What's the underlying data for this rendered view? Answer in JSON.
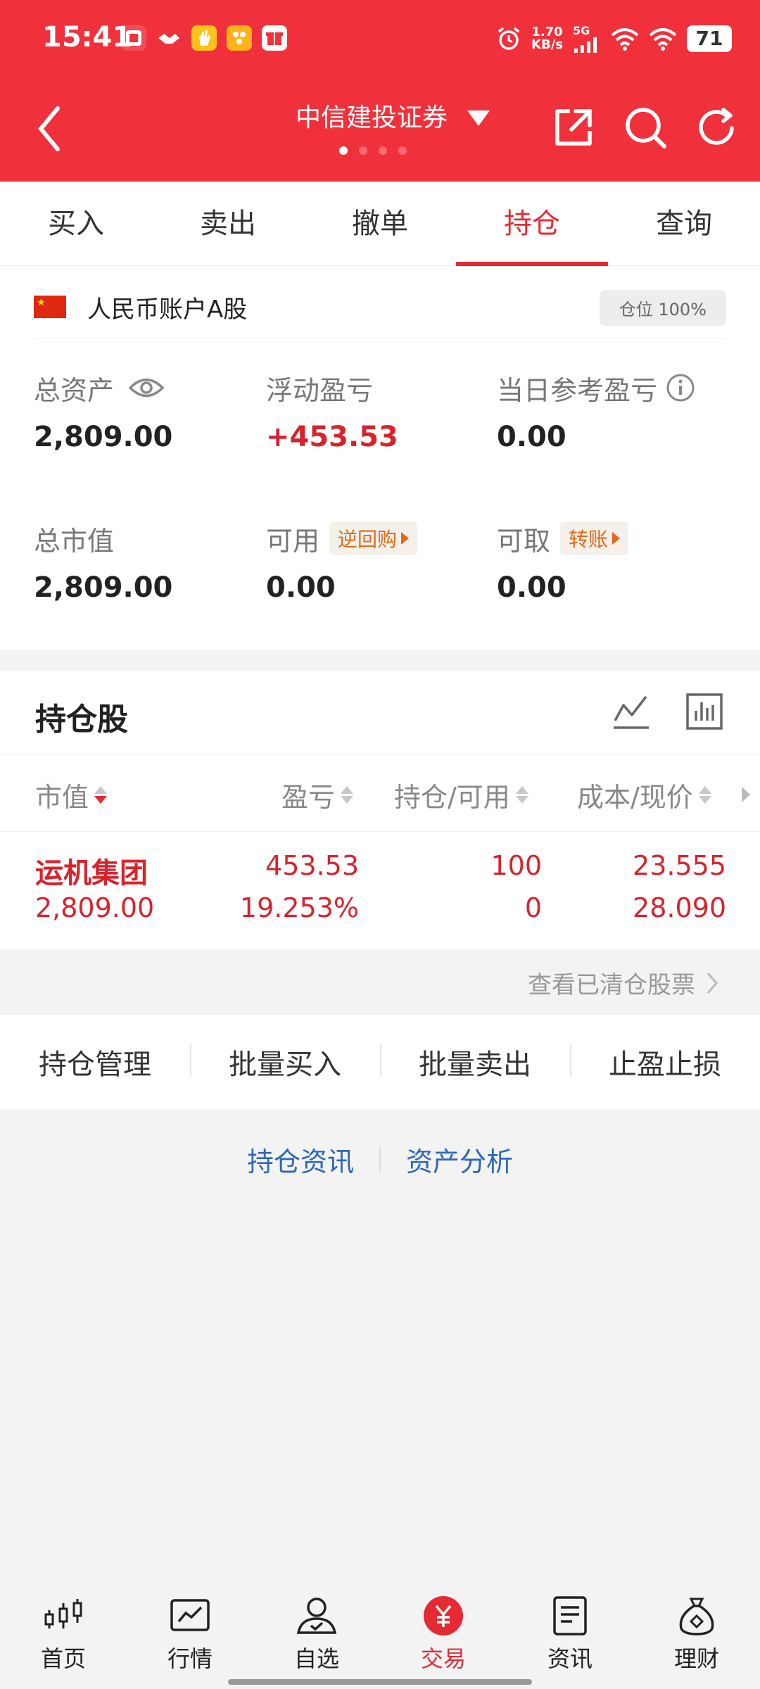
{
  "status_bar": {
    "time": "15:41",
    "speed_value": "1.70",
    "speed_unit": "KB/s",
    "network": "5G",
    "battery": "71"
  },
  "nav": {
    "title": "中信建投证券"
  },
  "tabs": [
    {
      "label": "买入"
    },
    {
      "label": "卖出"
    },
    {
      "label": "撤单"
    },
    {
      "label": "持仓",
      "active": true
    },
    {
      "label": "查询"
    }
  ],
  "account": {
    "name": "人民币账户A股",
    "position_badge": "仓位 100%",
    "total_assets_label": "总资产",
    "total_assets": "2,809.00",
    "floating_pl_label": "浮动盈亏",
    "floating_pl": "+453.53",
    "daily_pl_label": "当日参考盈亏",
    "daily_pl": "0.00",
    "market_value_label": "总市值",
    "market_value": "2,809.00",
    "available_label": "可用",
    "available_tag": "逆回购",
    "available": "0.00",
    "withdrawable_label": "可取",
    "withdrawable_tag": "转账",
    "withdrawable": "0.00"
  },
  "holdings": {
    "title": "持仓股",
    "columns": [
      "市值",
      "盈亏",
      "持仓/可用",
      "成本/现价"
    ],
    "rows": [
      {
        "name": "运机集团",
        "market_value": "2,809.00",
        "pl": "453.53",
        "pl_pct": "19.253%",
        "position": "100",
        "available": "0",
        "cost": "23.555",
        "price": "28.090"
      }
    ],
    "cleared_link": "查看已清仓股票"
  },
  "actions": [
    "持仓管理",
    "批量买入",
    "批量卖出",
    "止盈止损"
  ],
  "links": [
    "持仓资讯",
    "资产分析"
  ],
  "bottom_nav": [
    {
      "label": "首页",
      "icon": "candlestick-icon"
    },
    {
      "label": "行情",
      "icon": "chart-icon"
    },
    {
      "label": "自选",
      "icon": "user-check-icon"
    },
    {
      "label": "交易",
      "icon": "yuan-icon",
      "active": true
    },
    {
      "label": "资讯",
      "icon": "document-icon"
    },
    {
      "label": "理财",
      "icon": "money-bag-icon"
    }
  ],
  "colors": {
    "brand_red": "#f0313c",
    "up_red": "#d8232d",
    "link_blue": "#2f67b8",
    "tag_orange": "#e16a1a"
  }
}
